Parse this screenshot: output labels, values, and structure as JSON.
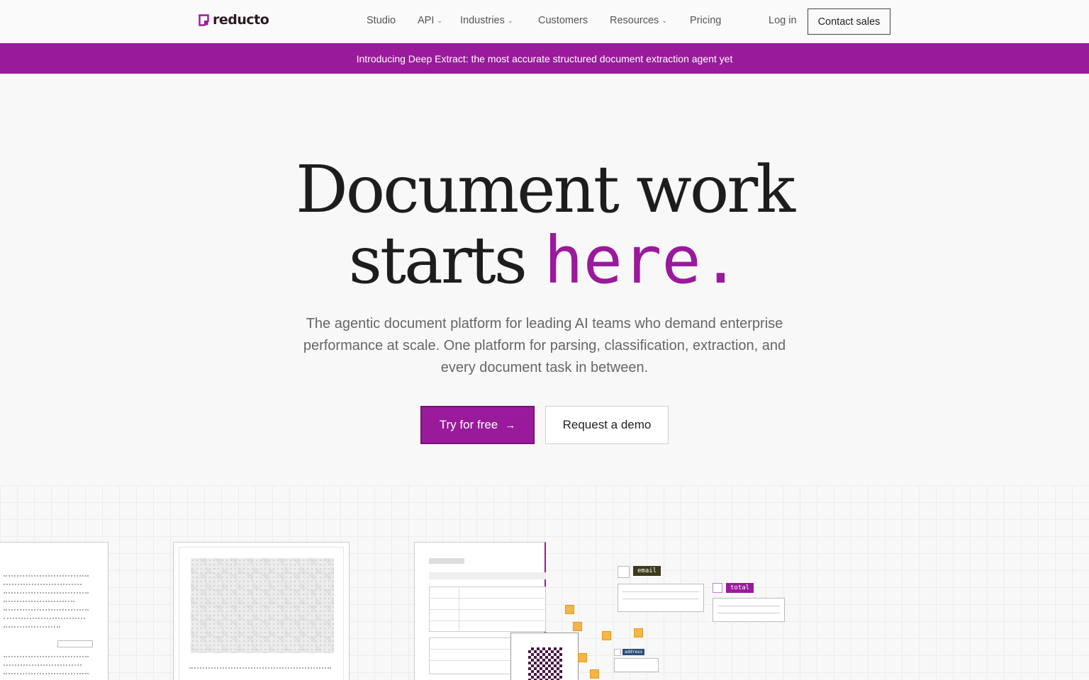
{
  "nav": {
    "brand": "reducto",
    "items": [
      {
        "label": "Studio",
        "dropdown": false
      },
      {
        "label": "API",
        "dropdown": true
      },
      {
        "label": "Industries",
        "dropdown": true
      },
      {
        "label": "Customers",
        "dropdown": false
      },
      {
        "label": "Resources",
        "dropdown": true
      },
      {
        "label": "Pricing",
        "dropdown": false
      }
    ],
    "login": "Log in",
    "contact": "Contact sales"
  },
  "banner": {
    "text": "Introducing Deep Extract: the most accurate structured document extraction agent yet"
  },
  "hero": {
    "headline_line1": "Document work",
    "headline_line2_prefix": "starts ",
    "headline_accent": "here.",
    "subtext": "The agentic document platform for leading AI teams who demand enterprise performance at scale. One platform for parsing, classification, extraction, and every document task in between.",
    "primary_cta": "Try for free",
    "primary_cta_arrow": "→",
    "secondary_cta": "Request a demo"
  },
  "illustration": {
    "tags": {
      "email": "email",
      "total": "total",
      "address": "address"
    }
  },
  "colors": {
    "brand": "#9a1a9c",
    "brand_dark": "#2a1a26",
    "email_tag": "#3c3a1c",
    "total_tag": "#9a1a9c",
    "address_tag": "#2e4e7a",
    "tile": "#f2b64a"
  }
}
